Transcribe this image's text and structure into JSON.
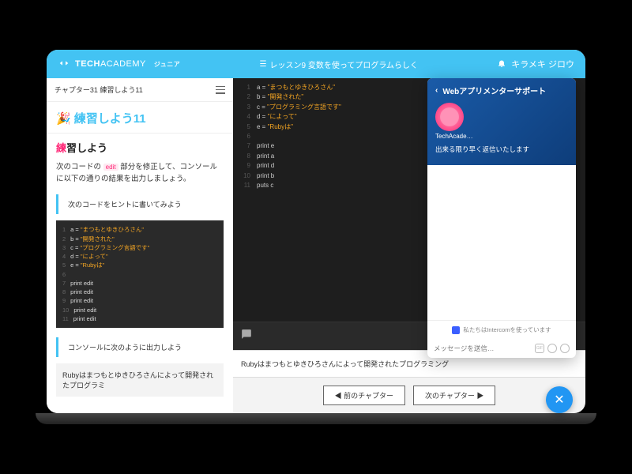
{
  "header": {
    "brand1": "TECH",
    "brand2": "ACADEMY",
    "junior": "ジュニア",
    "lesson": "レッスン9  変数を使ってプログラムらしく",
    "user": "キラメキ ジロウ"
  },
  "left": {
    "chapter": "チャプター31  練習しよう11",
    "title": "練習しよう11",
    "section": "習しよう",
    "section_prefix": "練",
    "body_pre": "次のコードの",
    "body_edit": "edit",
    "body_post": "部分を修正して、コンソールに以下の通りの結果を出力しましょう。",
    "hint": "次のコードをヒントに書いてみよう",
    "code_lines": [
      {
        "n": "1",
        "t": "a = ",
        "s": "\"まつもとゆきひろさん\""
      },
      {
        "n": "2",
        "t": "b = ",
        "s": "\"開発された\""
      },
      {
        "n": "3",
        "t": "c = ",
        "s": "\"プログラミング言語です\""
      },
      {
        "n": "4",
        "t": "d = ",
        "s": "\"によって\""
      },
      {
        "n": "5",
        "t": "e = ",
        "s": "\"Rubyは\""
      },
      {
        "n": "6",
        "t": "",
        "s": ""
      },
      {
        "n": "7",
        "t": "print edit",
        "s": ""
      },
      {
        "n": "8",
        "t": "print edit",
        "s": ""
      },
      {
        "n": "9",
        "t": "print edit",
        "s": ""
      },
      {
        "n": "10",
        "t": "print edit",
        "s": ""
      },
      {
        "n": "11",
        "t": "print edit",
        "s": ""
      }
    ],
    "console_head": "コンソールに次のように出力しよう",
    "expected": "Rubyはまつもとゆきひろさんによって開発されたプログラミ"
  },
  "editor": {
    "lines": [
      {
        "n": "1",
        "t": "a = ",
        "s": "\"まつもとゆきひろさん\""
      },
      {
        "n": "2",
        "t": "b = ",
        "s": "\"開発された\""
      },
      {
        "n": "3",
        "t": "c = ",
        "s": "\"プログラミング言語です\""
      },
      {
        "n": "4",
        "t": "d = ",
        "s": "\"によって\""
      },
      {
        "n": "5",
        "t": "e = ",
        "s": "\"Rubyは\""
      },
      {
        "n": "6",
        "t": "",
        "s": ""
      },
      {
        "n": "7",
        "t": "print e",
        "s": ""
      },
      {
        "n": "8",
        "t": "print a",
        "s": ""
      },
      {
        "n": "9",
        "t": "print d",
        "s": ""
      },
      {
        "n": "10",
        "t": "print b",
        "s": ""
      },
      {
        "n": "11",
        "t": "puts c",
        "s": ""
      }
    ],
    "output": "Rubyはまつもとゆきひろさんによって開発されたプログラミング"
  },
  "nav": {
    "prev": "前のチャプター",
    "next": "次のチャプター"
  },
  "chat": {
    "title": "Webアプリメンターサポート",
    "bot": "TechAcade…",
    "msg": "出来る限り早く返信いたします",
    "intercom": "私たちはIntercomを使っています",
    "placeholder": "メッセージを送信…",
    "gif": "GIF"
  }
}
